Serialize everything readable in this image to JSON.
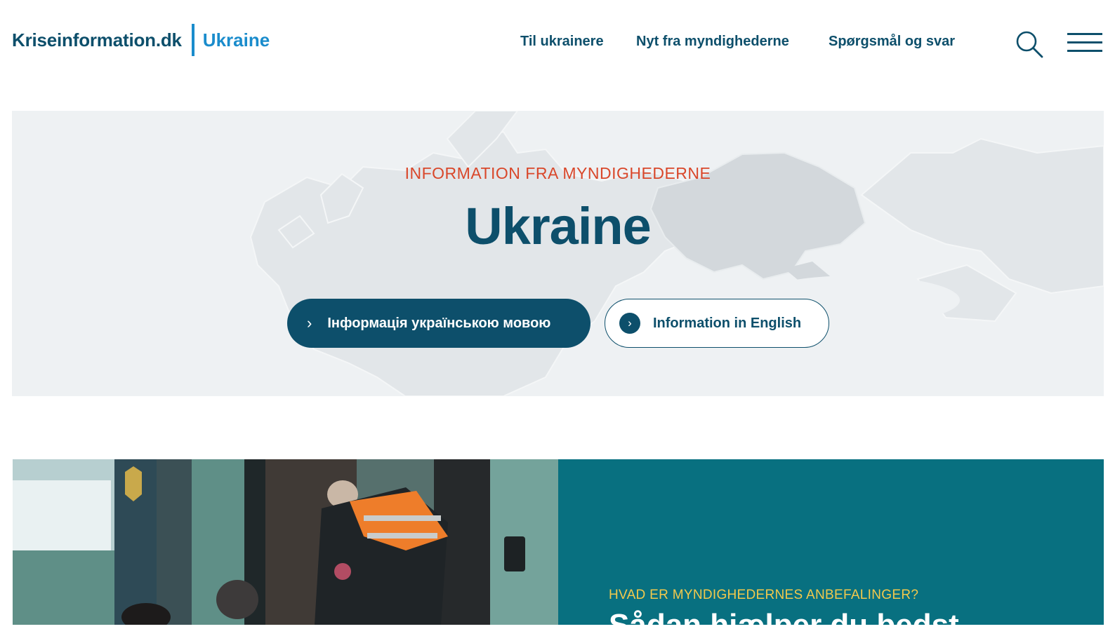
{
  "header": {
    "logo_main": "Kriseinformation.dk",
    "logo_sub": "Ukraine",
    "nav": [
      "Til ukrainere",
      "Nyt fra myndighederne",
      "Spørgsmål og svar"
    ],
    "search_icon": "search-icon",
    "menu_icon": "hamburger-menu-icon"
  },
  "hero": {
    "eyebrow": "INFORMATION FRA MYNDIGHEDERNE",
    "title": "Ukraine",
    "btn_ukrainian": "Інформація українською мовою",
    "btn_english": "Information in English"
  },
  "feature": {
    "kicker": "HVAD ER MYNDIGHEDERNES ANBEFALINGER?",
    "headline": "Sådan hjælper du bedst"
  },
  "colors": {
    "brand_dark": "#0d4f6b",
    "brand_blue": "#1a8ccc",
    "accent_orange": "#d9472a",
    "feature_teal": "#087080",
    "feature_yellow": "#f2c94c"
  }
}
